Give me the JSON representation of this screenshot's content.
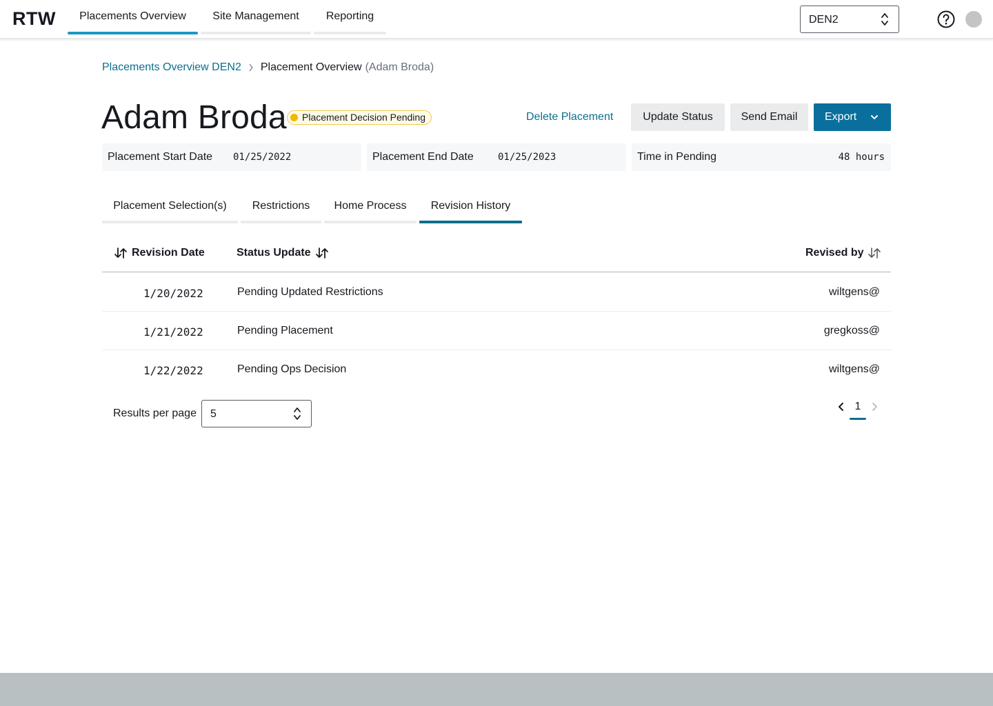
{
  "app": {
    "logo": "RTW"
  },
  "nav": {
    "tabs": [
      {
        "label": "Placements Overview",
        "active": true
      },
      {
        "label": "Site Management",
        "active": false
      },
      {
        "label": "Reporting",
        "active": false
      }
    ],
    "site_select": "DEN2",
    "help_icon": "question-circle-icon",
    "avatar": "user-avatar"
  },
  "breadcrumb": {
    "link": "Placements Overview DEN2",
    "current": "Placement Overview",
    "current_muted": "(Adam Broda)"
  },
  "header": {
    "name": "Adam Broda",
    "status_badge": "Placement Decision Pending",
    "status_color": "#f2b705",
    "actions": {
      "delete": "Delete Placement",
      "update_status": "Update Status",
      "send_email": "Send Email",
      "export": "Export"
    }
  },
  "info": {
    "start": {
      "label": "Placement Start Date",
      "value": "01/25/2022"
    },
    "end": {
      "label": "Placement End Date",
      "value": "01/25/2023"
    },
    "pending": {
      "label": "Time in Pending",
      "value": "48 hours"
    }
  },
  "tabs": [
    {
      "label": "Placement Selection(s)",
      "active": false
    },
    {
      "label": "Restrictions",
      "active": false
    },
    {
      "label": "Home Process",
      "active": false
    },
    {
      "label": "Revision History",
      "active": true
    }
  ],
  "table": {
    "headers": {
      "date": "Revision Date",
      "status": "Status Update",
      "revised_by": "Revised by"
    },
    "rows": [
      {
        "date": "1/20/2022",
        "status": "Pending Updated Restrictions",
        "revised_by": "wiltgens@"
      },
      {
        "date": "1/21/2022",
        "status": "Pending Placement",
        "revised_by": "gregkoss@"
      },
      {
        "date": "1/22/2022",
        "status": "Pending Ops Decision",
        "revised_by": "wiltgens@"
      }
    ]
  },
  "pagination": {
    "results_label": "Results per page",
    "results_value": "5",
    "current_page": "1"
  },
  "colors": {
    "accent": "#0a6f8f",
    "nav_accent": "#1e97c2",
    "primary_button": "#0a6f9c",
    "footer": "#b9c0c1"
  }
}
